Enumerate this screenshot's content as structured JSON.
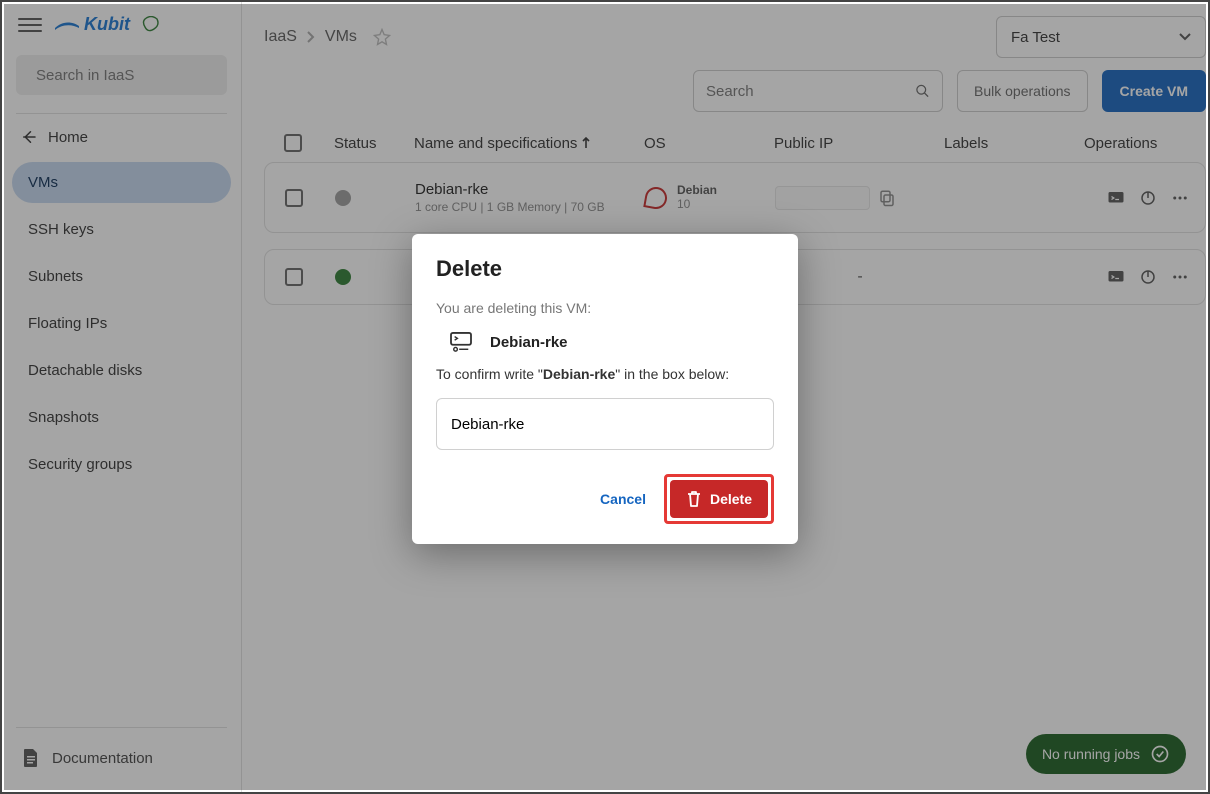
{
  "brand": "Kubit",
  "sidebar": {
    "search_placeholder": "Search in IaaS",
    "home": "Home",
    "items": [
      "VMs",
      "SSH keys",
      "Subnets",
      "Floating IPs",
      "Detachable disks",
      "Snapshots",
      "Security groups"
    ],
    "documentation": "Documentation"
  },
  "breadcrumb": {
    "root": "IaaS",
    "page": "VMs"
  },
  "project": "Fa Test",
  "toolbar": {
    "search_placeholder": "Search",
    "bulk": "Bulk operations",
    "create": "Create VM"
  },
  "table": {
    "headers": {
      "status": "Status",
      "name": "Name and specifications",
      "os": "OS",
      "ip": "Public IP",
      "labels": "Labels",
      "ops": "Operations"
    },
    "rows": [
      {
        "name": "Debian-rke",
        "spec": "1 core CPU | 1 GB Memory | 70 GB",
        "os_name": "Debian",
        "os_ver": "10",
        "ip_dash": ""
      },
      {
        "name": "",
        "spec": "",
        "os_name": "",
        "os_ver": "",
        "ip_dash": "-"
      }
    ]
  },
  "jobs": "No running jobs",
  "modal": {
    "title": "Delete",
    "subtitle": "You are deleting this VM:",
    "entity": "Debian-rke",
    "confirm_pre": "To confirm write \"",
    "confirm_bold": "Debian-rke",
    "confirm_post": "\" in the box below:",
    "input_value": "Debian-rke",
    "cancel": "Cancel",
    "delete": "Delete"
  }
}
